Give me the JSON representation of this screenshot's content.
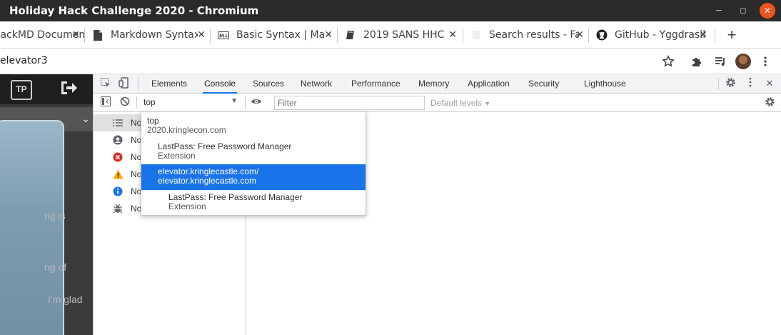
{
  "window": {
    "title": "Holiday Hack Challenge 2020 - Chromium",
    "controls": [
      "minimize",
      "maximize",
      "close"
    ]
  },
  "tabs": [
    {
      "label": "HackMD Document",
      "icon": "hackmd-icon"
    },
    {
      "label": "Markdown Syntax",
      "icon": "document-icon"
    },
    {
      "label": "Basic Syntax | Markdown",
      "icon": "markdown-icon"
    },
    {
      "label": "2019 SANS HHC",
      "icon": "book-icon"
    },
    {
      "label": "Search results - Fandom",
      "icon": "search-page-icon"
    },
    {
      "label": "GitHub - Yggdrasil",
      "icon": "github-icon"
    }
  ],
  "toolbar": {
    "url": "elevator3"
  },
  "page": {
    "logo_text": "TP",
    "texts": [
      "ng is",
      "ng of",
      "I'm glad"
    ]
  },
  "devtools": {
    "tabs": [
      "Elements",
      "Console",
      "Sources",
      "Network",
      "Performance",
      "Memory",
      "Application",
      "Security",
      "Lighthouse"
    ],
    "active_tab": "Console",
    "context": "top",
    "filter_placeholder": "Filter",
    "levels": "Default levels",
    "sidebar": [
      {
        "label": "No",
        "icon": "list-icon"
      },
      {
        "label": "No",
        "icon": "user-icon"
      },
      {
        "label": "No",
        "icon": "error-icon"
      },
      {
        "label": "No",
        "icon": "warning-icon"
      },
      {
        "label": "No",
        "icon": "info-icon"
      },
      {
        "label": "No",
        "icon": "bug-icon"
      }
    ],
    "context_menu": [
      {
        "line1": "top",
        "line2": "2020.kringlecon.com"
      },
      {
        "line1": "LastPass: Free Password Manager",
        "line2": "Extension"
      },
      {
        "line1": "elevator.kringlecastle.com/",
        "line2": "elevator.kringlecastle.com"
      },
      {
        "line1": "LastPass: Free Password Manager",
        "line2": "Extension"
      }
    ]
  },
  "colors": {
    "accent": "#1a73e8",
    "titlebar": "#2b2b2b",
    "close_button": "#e95420"
  }
}
